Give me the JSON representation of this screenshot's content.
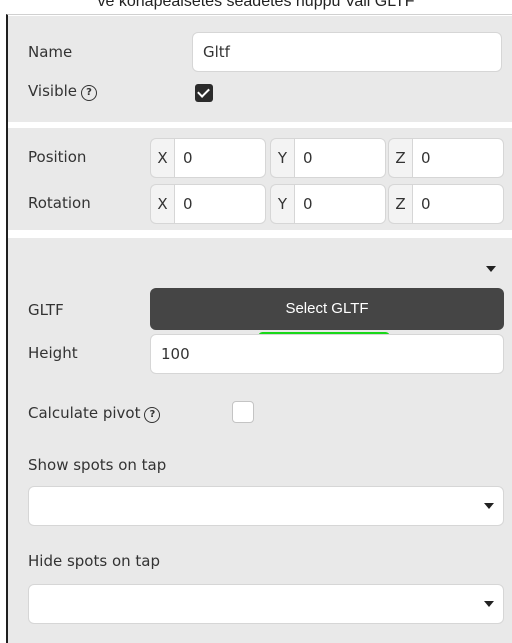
{
  "caption": "ve kohapealsetes seadetes nuppu Vali GLTF",
  "general": {
    "name_label": "Name",
    "name_value": "Gltf",
    "visible_label": "Visible",
    "help_glyph": "?",
    "visible_checked": true
  },
  "transform": {
    "position_label": "Position",
    "rotation_label": "Rotation",
    "position": {
      "x_label": "X",
      "x": "0",
      "y_label": "Y",
      "y": "0",
      "z_label": "Z",
      "z": "0"
    },
    "rotation": {
      "x_label": "X",
      "x": "0",
      "y_label": "Y",
      "y": "0",
      "z_label": "Z",
      "z": "0"
    }
  },
  "gltf": {
    "gltf_label": "GLTF",
    "select_button": "Select GLTF",
    "height_label": "Height",
    "height_value": "100",
    "calculate_pivot_label": "Calculate pivot",
    "calculate_pivot_checked": false,
    "show_spots_label": "Show spots on tap",
    "show_spots_value": "",
    "hide_spots_label": "Hide spots on tap",
    "hide_spots_value": ""
  },
  "colors": {
    "button_bg": "#454545",
    "highlight": "#19d819",
    "panel_bg": "#e9e9e9"
  }
}
